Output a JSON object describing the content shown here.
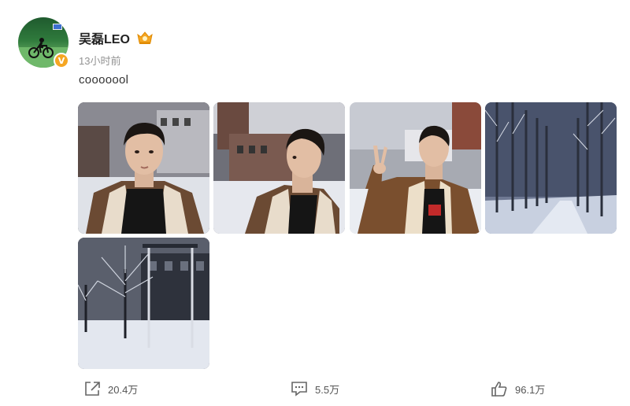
{
  "post": {
    "username": "吴磊LEO",
    "time": "13小时前",
    "text": "cooooool",
    "avatar_badge": "V",
    "photos": [
      {
        "icon": "photo-portrait-front"
      },
      {
        "icon": "photo-portrait-profile"
      },
      {
        "icon": "photo-portrait-peace-sign"
      },
      {
        "icon": "photo-snowy-tree-avenue"
      },
      {
        "icon": "photo-snowy-park-trees"
      }
    ]
  },
  "actions": {
    "share_count": "20.4万",
    "comment_count": "5.5万",
    "like_count": "96.1万"
  },
  "colors": {
    "vip_badge": "#f5a623",
    "time_text": "#939393",
    "action_text": "#555555"
  }
}
